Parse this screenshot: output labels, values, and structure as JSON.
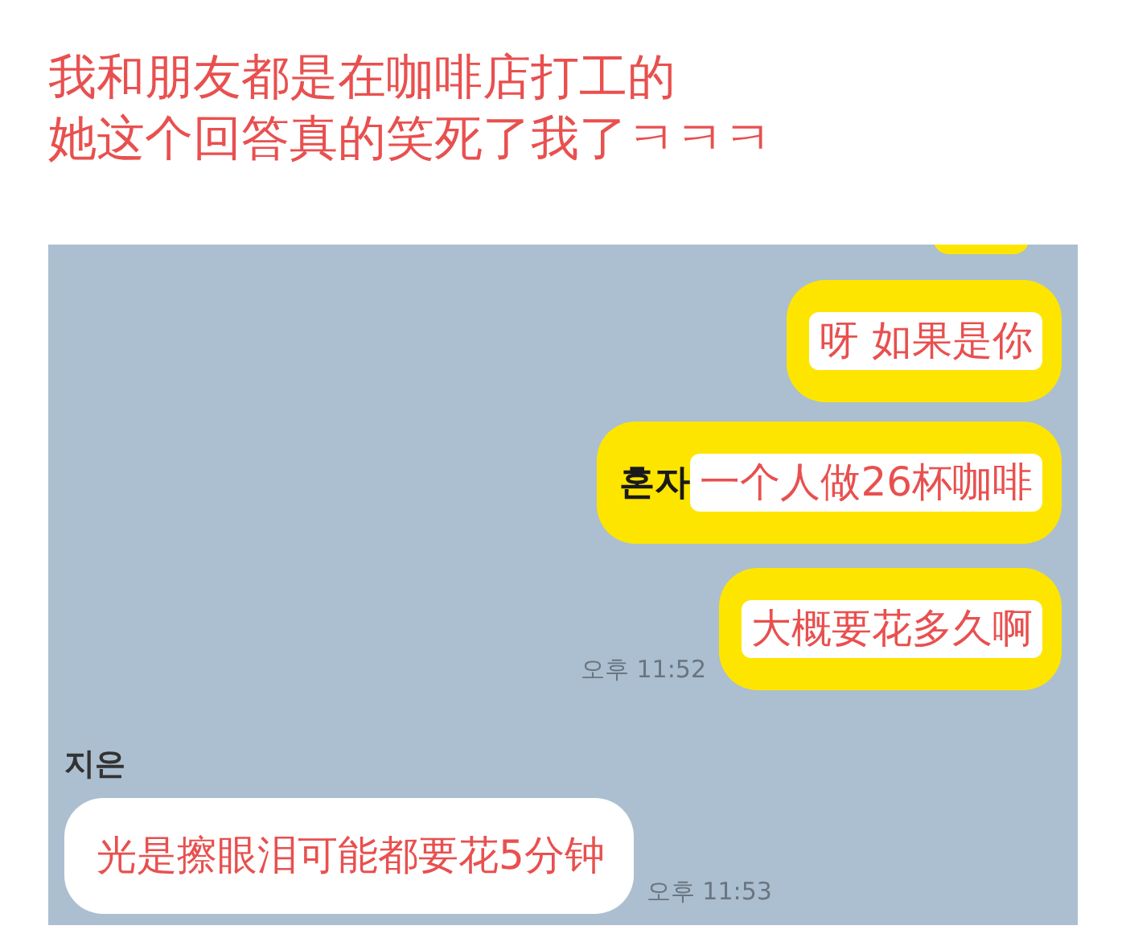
{
  "caption": [
    "我和朋友都是在咖啡店打工的",
    "她这个回答真的笑死了我了ㅋㅋㅋ"
  ],
  "chat": {
    "messages": [
      {
        "kind": "sent",
        "translation": "呀 如果是你"
      },
      {
        "kind": "sent",
        "original": "혼자",
        "translation": "一个人做26杯咖啡"
      },
      {
        "kind": "sent",
        "translation": "大概要花多久啊",
        "time": "오후 11:52"
      },
      {
        "kind": "received",
        "sender": "지은",
        "translation": "光是擦眼泪可能都要花5分钟",
        "time": "오후 11:53"
      }
    ]
  }
}
